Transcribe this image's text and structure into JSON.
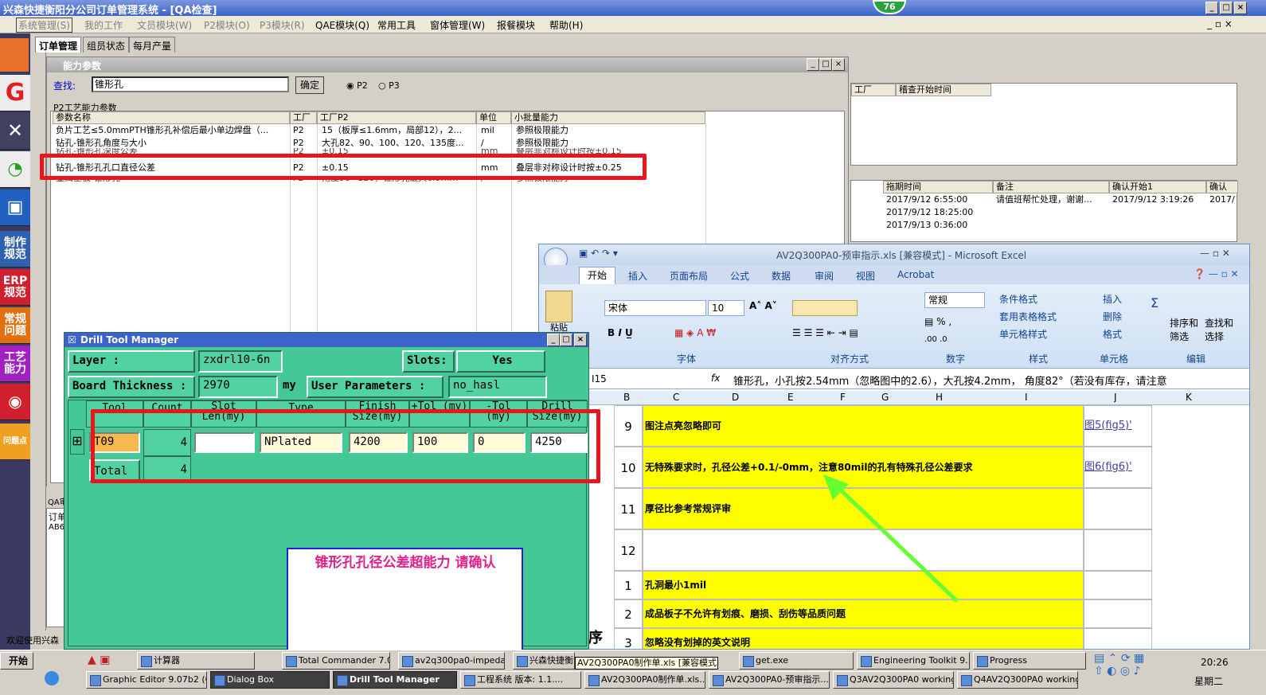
{
  "window_title": "兴森快捷衡阳分公司订单管理系统 - [QA检查]",
  "badge": "76",
  "menus": [
    "系统管理(S)",
    "我的工作",
    "文员模块(W)",
    "P2模块(O)",
    "P3模块(R)",
    "QAE模块(Q)",
    "常用工具",
    "窗体管理(W)",
    "报餐模块",
    "帮助(H)"
  ],
  "left_tools": [
    "制作规范",
    "ERP规范",
    "常规问题",
    "工艺能力",
    "问题点"
  ],
  "tabs": [
    "订单管理",
    "组员状态",
    "每月产量"
  ],
  "ability": {
    "title": "能力参数",
    "search_label": "查找:",
    "search_value": "锥形孔",
    "confirm": "确定",
    "radio1": "P2",
    "radio2": "P3",
    "group": "P2工艺能力参数",
    "cols": [
      "参数名称",
      "工厂",
      "工厂P2",
      "单位",
      "小批量能力"
    ],
    "rows": [
      [
        "负片工艺≤5.0mmPTH锥形孔补偿后最小单边焊盘（...",
        "P2",
        "15（板厚≤1.6mm，局部12），2...",
        "mil",
        "参照极限能力"
      ],
      [
        "钻孔-锥形孔角度与大小",
        "P2",
        "大孔82、90、100、120、135度...",
        "/",
        "参照极限能力"
      ],
      [
        "钻孔-锥形孔深度公差",
        "P2",
        "±0.15",
        "mm",
        "叠层非对称设计时按±0.15"
      ],
      [
        "钻孔-锥形孔孔口直径公差",
        "P2",
        "±0.15",
        "mm",
        "叠层非对称设计时按±0.25"
      ],
      [
        "金属基板-锥形孔",
        "P2",
        "角度90~120，锥形孔最大6.5mm",
        "/",
        "参照极限能力"
      ]
    ]
  },
  "right_top": {
    "cols": [
      "工厂",
      "稽查开始时间"
    ]
  },
  "right_mid": {
    "cols": [
      "拖期时间",
      "备注",
      "确认开始1",
      "确认"
    ],
    "rows": [
      [
        "2017/9/12 6:55:00",
        "请值班帮忙处理，谢谢...",
        "2017/9/12 3:19:26",
        "2017/"
      ],
      [
        "2017/9/12 18:25:00",
        "",
        "",
        ""
      ],
      [
        "2017/9/13 0:36:00",
        "",
        "",
        ""
      ]
    ]
  },
  "excel": {
    "title": "AV2Q300PA0-预审指示.xls  [兼容模式] - Microsoft Excel",
    "tabs": [
      "开始",
      "插入",
      "页面布局",
      "公式",
      "数据",
      "审阅",
      "视图",
      "Acrobat"
    ],
    "paste": "粘贴",
    "font_name": "宋体",
    "font_size": "10",
    "number_format": "常规",
    "style_items": [
      "条件格式",
      "套用表格格式",
      "单元格样式"
    ],
    "cell_items": [
      "插入",
      "删除",
      "格式"
    ],
    "edit_items": [
      "排序和筛选",
      "查找和选择"
    ],
    "groups": [
      "字体",
      "对齐方式",
      "数字",
      "样式",
      "单元格",
      "编辑"
    ],
    "name_box": "I15",
    "fx": "fx",
    "formula": "锥形孔，小孔按2.54mm（忽略图中的2.6），大孔按4.2mm， 角度82°（若没有库存，请注意",
    "col_headers": [
      "B",
      "C",
      "D",
      "E",
      "F",
      "G",
      "H",
      "I",
      "J",
      "K"
    ],
    "rows": [
      {
        "num": "9",
        "text": "图注点亮忽略即可",
        "link": "图5(fig5)'",
        "yellow": true
      },
      {
        "num": "10",
        "text": "无特殊要求时，孔径公差+0.1/-0mm，注意80mil的孔有特殊孔径公差要求",
        "link": "图6(fig6)'",
        "yellow": true
      },
      {
        "num": "11",
        "text": "厚径比参考常规评审",
        "link": "",
        "yellow": true
      },
      {
        "num": "12",
        "text": "",
        "link": "",
        "yellow": false
      },
      {
        "num": "1",
        "text": "孔洞最小1mil",
        "link": "",
        "yellow": true
      },
      {
        "num": "2",
        "text": "成品板子不允许有划痕、磨损、刮伤等品质问题",
        "link": "",
        "yellow": true
      },
      {
        "num": "3",
        "text": "忽略没有划掉的英文说明",
        "link": "",
        "yellow": true
      }
    ],
    "side_char": "序"
  },
  "dtm": {
    "title": "Drill Tool Manager",
    "layer_label": "Layer           :",
    "layer_value": "zxdrl10-6n",
    "slots_label": "Slots:",
    "slots_value": "Yes",
    "thickness_label": "Board Thickness :",
    "thickness_value": "2970",
    "thickness_unit": "my",
    "user_param_label": "User Parameters :",
    "user_param_value": "no_hasl",
    "grid_cols": [
      "Tool",
      "Count",
      "Slot Len(my)",
      "Type",
      "Finish Size(my)",
      "+Tol (my)",
      "-Tol (my)",
      "Drill Size(my)"
    ],
    "row": {
      "tool": "T09",
      "count": "4",
      "slot": "",
      "type": "NPlated",
      "finish": "4200",
      "ptol": "100",
      "ntol": "0",
      "drill": "4250"
    },
    "total_label": "Total",
    "total_count": "4"
  },
  "dialog_note": "锥形孔孔径公差超能力  请确认",
  "status_left": "欢迎使用兴森",
  "qa_label": "QA审",
  "order_label": "订单",
  "order_value": "AB6",
  "taskbar": {
    "start": "开始",
    "row1": [
      "计算器",
      "Total Commander 7.0...",
      "av2q300pa0-impeda...",
      "兴森快捷衡阳分公司...",
      "get.exe",
      "Engineering Toolkit 9....",
      "Progress"
    ],
    "tooltip": "AV2Q300PA0制作单.xls  [兼容模式]",
    "row2": [
      "Graphic Editor 9.07b2 (0...",
      "Dialog Box",
      "Drill Tool Manager",
      "工程系统  版本: 1.1....",
      "AV2Q300PA0制作单.xls...",
      "AV2Q300PA0-预审指示...",
      "Q3AV2Q300PA0 working...",
      "Q4AV2Q300PA0 working..."
    ],
    "time": "20:26",
    "day": "星期二"
  }
}
